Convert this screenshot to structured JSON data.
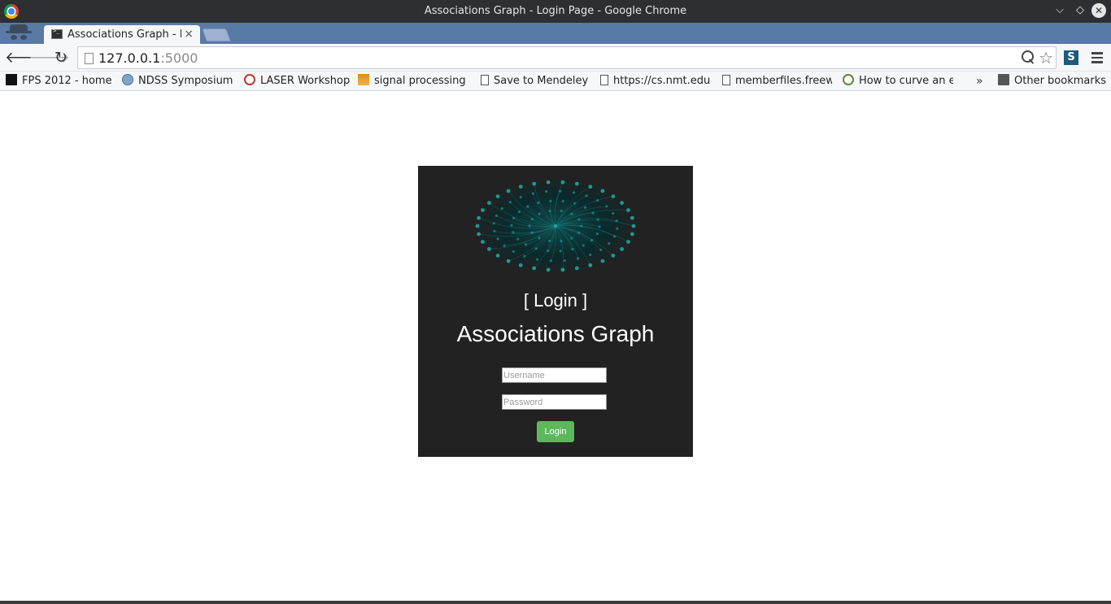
{
  "window": {
    "title": "Associations Graph - Login Page - Google Chrome",
    "controls": {
      "minimize": "⌵",
      "maximize": "◇",
      "close": "✕"
    }
  },
  "tabs": [
    {
      "label": "Associations Graph - Login Page",
      "close": "×",
      "active": true
    }
  ],
  "toolbar": {
    "back": "🡐",
    "forward": "🡒",
    "reload": "↻",
    "url_host": "127.0.0.1",
    "url_port": ":5000",
    "star": "☆",
    "extension_label": "S"
  },
  "bookmarks": {
    "items": [
      {
        "label": "FPS 2012 - home",
        "icon": "black-square-icon"
      },
      {
        "label": "NDSS Symposium",
        "icon": "ndss-icon"
      },
      {
        "label": "LASER Workshop",
        "icon": "cert-icon"
      },
      {
        "label": "signal processing",
        "icon": "stackexchange-icon"
      },
      {
        "label": "Save to Mendeley",
        "icon": "page-icon"
      },
      {
        "label": "https://cs.nmt.edu",
        "icon": "page-icon"
      },
      {
        "label": "memberfiles.freew",
        "icon": "page-icon"
      },
      {
        "label": "How to curve an e",
        "icon": "knot-icon"
      }
    ],
    "more": "»",
    "other": "Other bookmarks"
  },
  "login": {
    "heading": "[ Login ]",
    "app_title": "Associations Graph",
    "username_placeholder": "Username",
    "password_placeholder": "Password",
    "button_label": "Login"
  },
  "colors": {
    "login_bg": "#222222",
    "button_green": "#5cb85c",
    "graph_teal": "#1fa5a0"
  }
}
